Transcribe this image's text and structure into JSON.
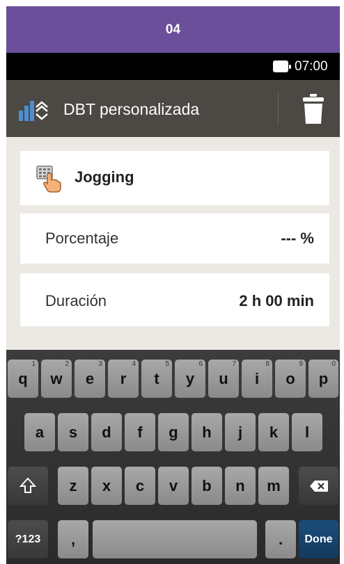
{
  "step_header": {
    "number": "04"
  },
  "status_bar": {
    "time": "07:00"
  },
  "app_bar": {
    "title": "DBT personalizada"
  },
  "activity": {
    "label": "Jogging"
  },
  "rows": [
    {
      "label": "Porcentaje",
      "value": "--- %"
    },
    {
      "label": "Duración",
      "value": "2 h 00 min"
    }
  ],
  "keyboard": {
    "row1": [
      {
        "key": "q",
        "hint": "1"
      },
      {
        "key": "w",
        "hint": "2"
      },
      {
        "key": "e",
        "hint": "3"
      },
      {
        "key": "r",
        "hint": "4"
      },
      {
        "key": "t",
        "hint": "5"
      },
      {
        "key": "y",
        "hint": "6"
      },
      {
        "key": "u",
        "hint": "7"
      },
      {
        "key": "i",
        "hint": "8"
      },
      {
        "key": "o",
        "hint": "9"
      },
      {
        "key": "p",
        "hint": "0"
      }
    ],
    "row2": [
      "a",
      "s",
      "d",
      "f",
      "g",
      "h",
      "j",
      "k",
      "l"
    ],
    "row3": [
      "z",
      "x",
      "c",
      "v",
      "b",
      "n",
      "m"
    ],
    "symbols_label": "?123",
    "comma": ",",
    "period": ".",
    "done_label": "Done",
    "shift_icon": "shift-icon",
    "backspace_icon": "backspace-icon"
  },
  "colors": {
    "step_header": "#6b4f9a",
    "app_bar": "#4c4844",
    "done_key": "#1b4d7b"
  }
}
